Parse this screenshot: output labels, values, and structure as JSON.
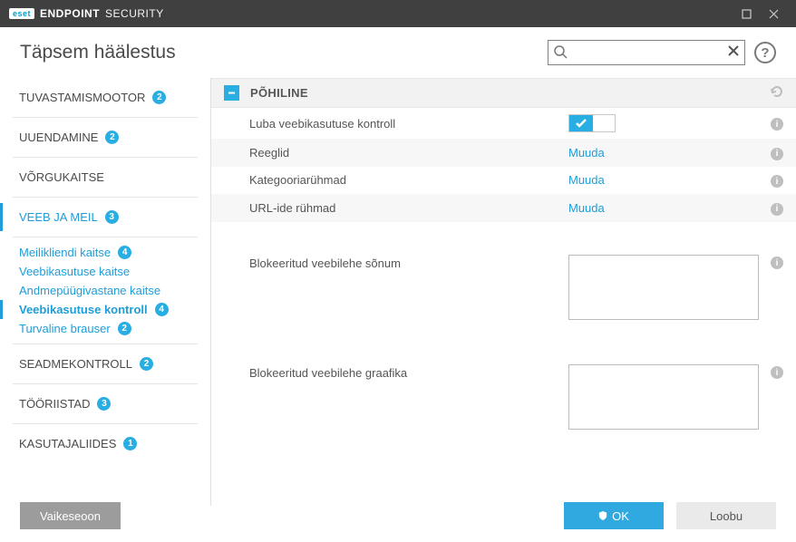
{
  "titlebar": {
    "brand_badge": "eset",
    "brand_strong": "ENDPOINT",
    "brand_light": "SECURITY"
  },
  "header": {
    "page_title": "Täpsem häälestus",
    "search_placeholder": "",
    "help": "?"
  },
  "sidebar": {
    "items": [
      {
        "label": "TUVASTAMISMOOTOR",
        "badge": "2"
      },
      {
        "label": "UUENDAMINE",
        "badge": "2"
      },
      {
        "label": "VÕRGUKAITSE",
        "badge": ""
      },
      {
        "label": "VEEB JA MEIL",
        "badge": "3"
      }
    ],
    "subitems": [
      {
        "label": "Meilikliendi kaitse",
        "badge": "4"
      },
      {
        "label": "Veebikasutuse kaitse",
        "badge": ""
      },
      {
        "label": "Andmepüügivastane kaitse",
        "badge": ""
      },
      {
        "label": "Veebikasutuse kontroll",
        "badge": "4"
      },
      {
        "label": "Turvaline brauser",
        "badge": "2"
      }
    ],
    "items2": [
      {
        "label": "SEADMEKONTROLL",
        "badge": "2"
      },
      {
        "label": "TÖÖRIISTAD",
        "badge": "3"
      },
      {
        "label": "KASUTAJALIIDES",
        "badge": "1"
      }
    ]
  },
  "section": {
    "title": "PÕHILINE",
    "rows": {
      "enable": "Luba veebikasutuse kontroll",
      "rules": "Reeglid",
      "catgroups": "Kategooriarühmad",
      "urlgroups": "URL-ide rühmad",
      "edit": "Muuda",
      "blocked_msg": "Blokeeritud veebilehe sõnum",
      "blocked_gfx": "Blokeeritud veebilehe graafika"
    }
  },
  "footer": {
    "default": "Vaikeseoon",
    "ok": "OK",
    "cancel": "Loobu"
  }
}
